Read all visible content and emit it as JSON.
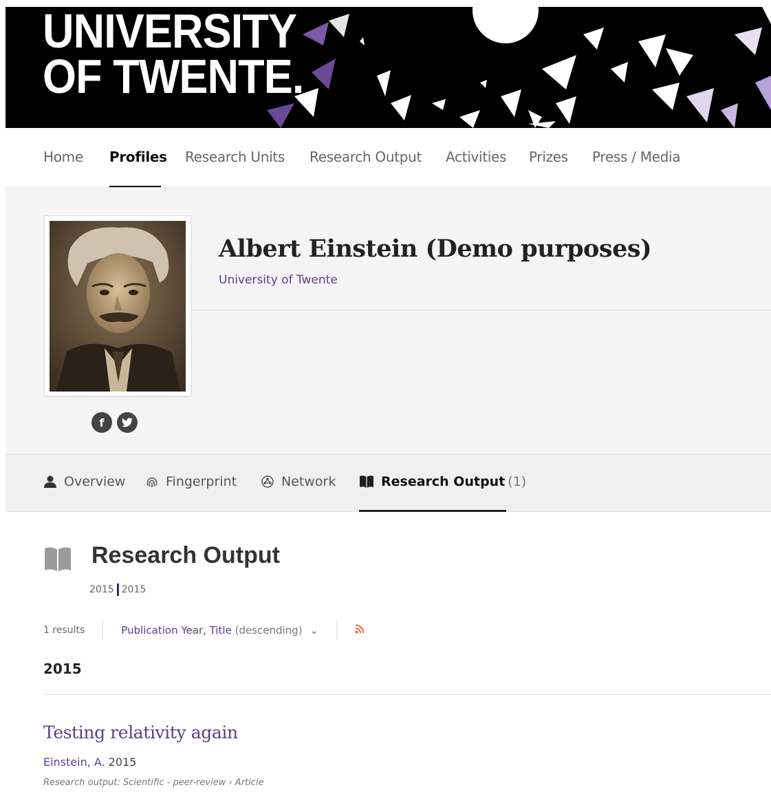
{
  "banner": {
    "logo_line1": "UNIVERSITY",
    "logo_line2": "OF TWENTE."
  },
  "topnav": {
    "items": [
      "Home",
      "Profiles",
      "Research Units",
      "Research Output",
      "Activities",
      "Prizes",
      "Press / Media"
    ],
    "active": "Profiles"
  },
  "profile": {
    "name": "Albert Einstein (Demo purposes)",
    "affiliation": "University of Twente",
    "social": [
      "f",
      "t"
    ]
  },
  "tabs": {
    "overview": "Overview",
    "fingerprint": "Fingerprint",
    "network": "Network",
    "research_output": "Research Output",
    "research_output_count": "(1)"
  },
  "research_output": {
    "title": "Research Output",
    "year_from": "2015",
    "year_to": "2015",
    "results": "1 results",
    "sort_label": "Publication Year, Title",
    "sort_order": "(descending)",
    "sort_chevron": "⌄",
    "rss_glyph": "⋰",
    "year_heading": "2015",
    "items": [
      {
        "title": "Testing relativity again",
        "authors": "Einstein, A.",
        "year": "2015",
        "type": "Research output: Scientific - peer-review › Article"
      }
    ]
  },
  "colors": {
    "accent": "#5a3e8c",
    "banner_bg": "#000000",
    "rss": "#e8692c"
  },
  "icons": [
    "person-icon",
    "fingerprint-icon",
    "network-icon",
    "book-icon",
    "facebook-icon",
    "twitter-icon",
    "rss-icon",
    "chevron-down-icon"
  ]
}
